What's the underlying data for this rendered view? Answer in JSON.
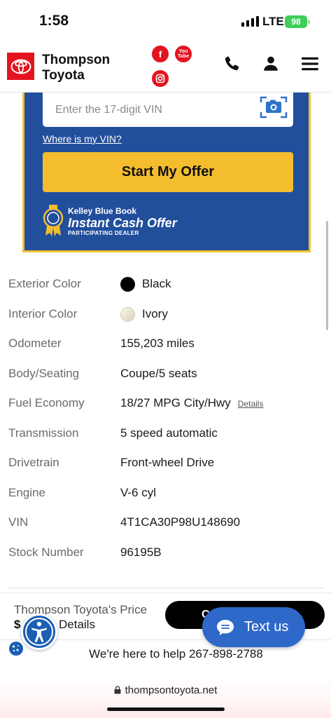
{
  "status_bar": {
    "time": "1:58",
    "network": "LTE",
    "battery": "98"
  },
  "header": {
    "dealer_line1": "Thompson",
    "dealer_line2": "Toyota",
    "social": {
      "facebook": "f",
      "youtube": "You Tube",
      "instagram": "ig"
    }
  },
  "offer": {
    "vin_placeholder": "Enter the 17-digit VIN",
    "vin_link": "Where is my VIN?",
    "start_button": "Start My Offer",
    "kbb_line1": "Kelley Blue Book",
    "kbb_line2": "Instant Cash Offer",
    "kbb_line3": "PARTICIPATING DEALER"
  },
  "specs": {
    "exterior_color": {
      "label": "Exterior Color",
      "value": "Black",
      "swatch": "#000000"
    },
    "interior_color": {
      "label": "Interior Color",
      "value": "Ivory",
      "swatch": "#efedd8"
    },
    "odometer": {
      "label": "Odometer",
      "value": "155,203 miles"
    },
    "body": {
      "label": "Body/Seating",
      "value": "Coupe/5 seats"
    },
    "fuel": {
      "label": "Fuel Economy",
      "value": "18/27 MPG City/Hwy",
      "link": "Details"
    },
    "transmission": {
      "label": "Transmission",
      "value": "5 speed automatic"
    },
    "drivetrain": {
      "label": "Drivetrain",
      "value": "Front-wheel Drive"
    },
    "engine": {
      "label": "Engine",
      "value": "V-6 cyl"
    },
    "vin": {
      "label": "VIN",
      "value": "4T1CA30P98U148690"
    },
    "stock": {
      "label": "Stock Number",
      "value": "96195B"
    }
  },
  "bottom": {
    "price_label": "Thompson Toyota's Price",
    "price_value": "$",
    "price_details": "Details",
    "cta_partial": "C",
    "text_us": "Text us",
    "help": "We're here to help 267-898-2788"
  },
  "browser": {
    "url": "thompsontoyota.net"
  },
  "colors": {
    "brand_red": "#e3141f",
    "offer_blue": "#214f9c",
    "offer_yellow": "#f4bd2d",
    "chat_blue": "#2e68c9"
  }
}
